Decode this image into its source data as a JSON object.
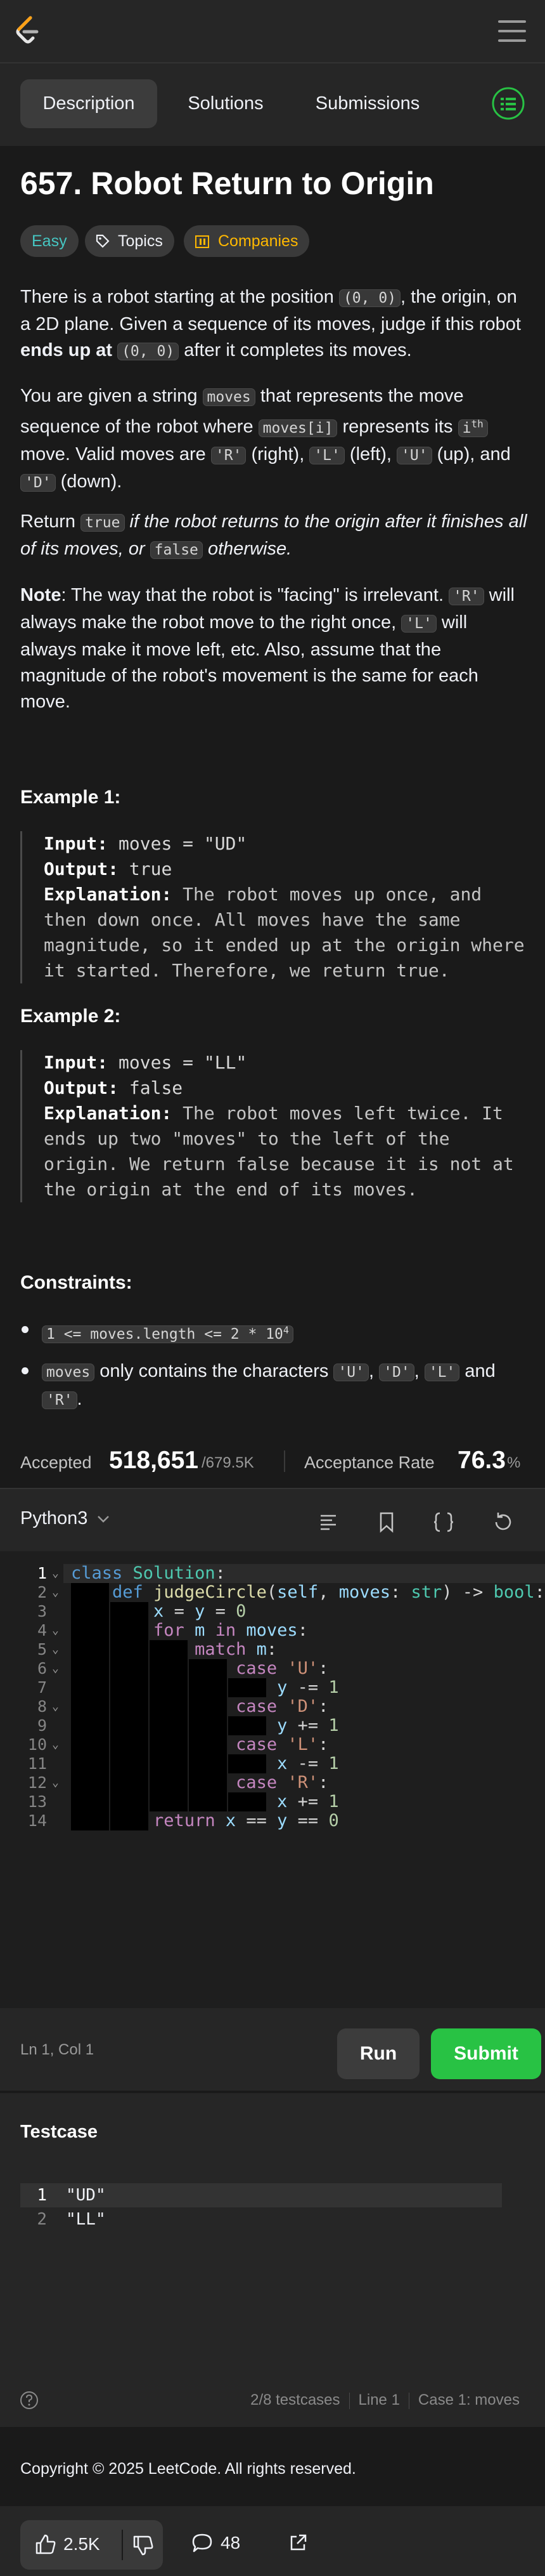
{
  "header": {
    "logo": "leetcode-logo",
    "menu_icon": "hamburger-icon"
  },
  "tabs": [
    {
      "label": "Description",
      "active": true
    },
    {
      "label": "Solutions",
      "active": false
    },
    {
      "label": "Submissions",
      "active": false
    }
  ],
  "problem": {
    "title": "657. Robot Return to Origin",
    "difficulty": "Easy",
    "topics_label": "Topics",
    "companies_label": "Companies",
    "p1": {
      "a": "There is a robot starting at the position ",
      "c1": "(0, 0)",
      "b": ", the origin, on a 2D plane. Given a sequence of its moves, judge if this robot ",
      "strong": "ends up at ",
      "c2": "(0, 0)",
      "d": " after it completes its moves."
    },
    "p2": {
      "a": "You are given a string ",
      "c1": "moves",
      "b": " that represents the move sequence of the robot where ",
      "c2": "moves[i]",
      "c": " represents its ",
      "c3": "i",
      "sup": "th",
      "d": " move. Valid moves are ",
      "c4": "'R'",
      "e": " (right), ",
      "c5": "'L'",
      "f": " (left), ",
      "c6": "'U'",
      "g": " (up), and ",
      "c7": "'D'",
      "h": " (down)."
    },
    "p3": {
      "a": "Return ",
      "c1": "true",
      "b": " if the robot returns to the origin after it finishes all of its moves, or ",
      "c2": "false",
      "c": " otherwise."
    },
    "p4": {
      "strong": "Note",
      "a": ": The way that the robot is \"facing\" is irrelevant. ",
      "c1": "'R'",
      "b": " will always make the robot move to the right once, ",
      "c2": "'L'",
      "c": " will always make it move left, etc. Also, assume that the magnitude of the robot's movement is the same for each move."
    },
    "examples": [
      {
        "heading": "Example 1:",
        "input_label": "Input:",
        "input": " moves = \"UD\"",
        "output_label": "Output:",
        "output": " true",
        "expl_label": "Explanation:",
        "expl": " The robot moves up once, and then down once. All moves have the same magnitude, so it ended up at the origin where it started. Therefore, we return true."
      },
      {
        "heading": "Example 2:",
        "input_label": "Input:",
        "input": " moves = \"LL\"",
        "output_label": "Output:",
        "output": " false",
        "expl_label": "Explanation:",
        "expl": " The robot moves left twice. It ends up two \"moves\" to the left of the origin. We return false because it is not at the origin at the end of its moves."
      }
    ],
    "constraints_heading": "Constraints:",
    "constraint1": {
      "code": "1 <= moves.length <= 2 * 10",
      "sup": "4"
    },
    "constraint2": {
      "c1": "moves",
      "a": " only contains the characters ",
      "c2": "'U'",
      "b": ", ",
      "c3": "'D'",
      "c": ", ",
      "c4": "'L'",
      "d": " and ",
      "c5": "'R'",
      "e": "."
    },
    "accepted_label": "Accepted",
    "accepted_value": "518,651",
    "accepted_total": "/679.5K",
    "rate_label": "Acceptance Rate",
    "rate_value": "76.3",
    "rate_unit": "%"
  },
  "editor": {
    "language": "Python3",
    "line_numbers": [
      "1",
      "2",
      "3",
      "4",
      "5",
      "6",
      "7",
      "8",
      "9",
      "10",
      "11",
      "12",
      "13",
      "14"
    ],
    "cursor_position": "Ln 1, Col 1",
    "run_label": "Run",
    "submit_label": "Submit"
  },
  "testcase": {
    "heading": "Testcase",
    "lines": [
      {
        "n": "1",
        "text": "\"UD\""
      },
      {
        "n": "2",
        "text": "\"LL\""
      }
    ],
    "count": "2/8 testcases",
    "line": "Line 1",
    "case": "Case 1: moves"
  },
  "footer": {
    "copyright": "Copyright © 2025 LeetCode. All rights reserved."
  },
  "bottom": {
    "likes": "2.5K",
    "comments": "48"
  },
  "colors": {
    "accent_green": "#28c244",
    "easy": "#46c6c2",
    "companies": "#ffb800",
    "background": "#1a1a1a"
  }
}
